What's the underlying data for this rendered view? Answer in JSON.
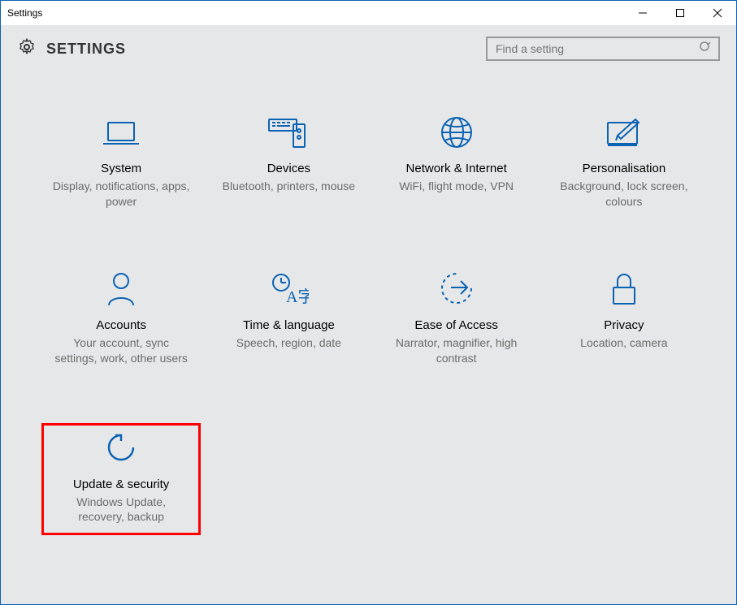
{
  "window": {
    "title": "Settings"
  },
  "header": {
    "title": "SETTINGS"
  },
  "search": {
    "placeholder": "Find a setting"
  },
  "tiles": [
    {
      "title": "System",
      "sub": "Display, notifications, apps, power"
    },
    {
      "title": "Devices",
      "sub": "Bluetooth, printers, mouse"
    },
    {
      "title": "Network & Internet",
      "sub": "WiFi, flight mode, VPN"
    },
    {
      "title": "Personalisation",
      "sub": "Background, lock screen, colours"
    },
    {
      "title": "Accounts",
      "sub": "Your account, sync settings, work, other users"
    },
    {
      "title": "Time & language",
      "sub": "Speech, region, date"
    },
    {
      "title": "Ease of Access",
      "sub": "Narrator, magnifier, high contrast"
    },
    {
      "title": "Privacy",
      "sub": "Location, camera"
    },
    {
      "title": "Update & security",
      "sub": "Windows Update, recovery, backup"
    }
  ]
}
